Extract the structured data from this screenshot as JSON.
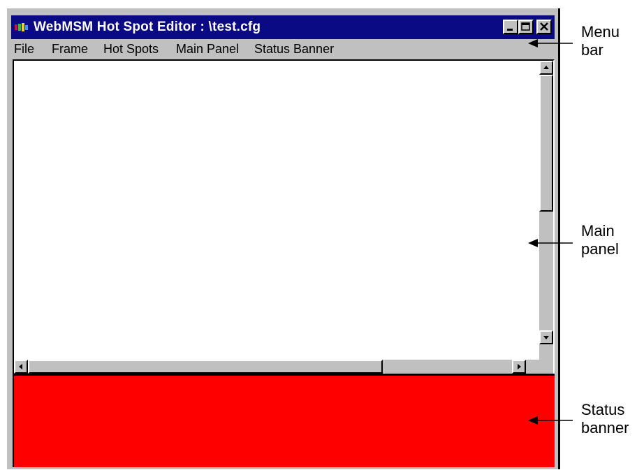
{
  "window": {
    "title": "WebMSM Hot Spot Editor : \\test.cfg",
    "icon": "app-icon",
    "controls": [
      "minimize-icon",
      "maximize-icon",
      "close-icon"
    ]
  },
  "menubar": {
    "items": [
      "File",
      "Frame",
      "Hot Spots",
      "Main Panel",
      "Status Banner"
    ]
  },
  "status_banner": {
    "color": "#ff0000"
  },
  "callouts": {
    "menu_bar": {
      "line1": "Menu",
      "line2": "bar"
    },
    "main_panel": {
      "line1": "Main",
      "line2": "panel"
    },
    "status_banner": {
      "line1": "Status",
      "line2": "banner"
    }
  }
}
